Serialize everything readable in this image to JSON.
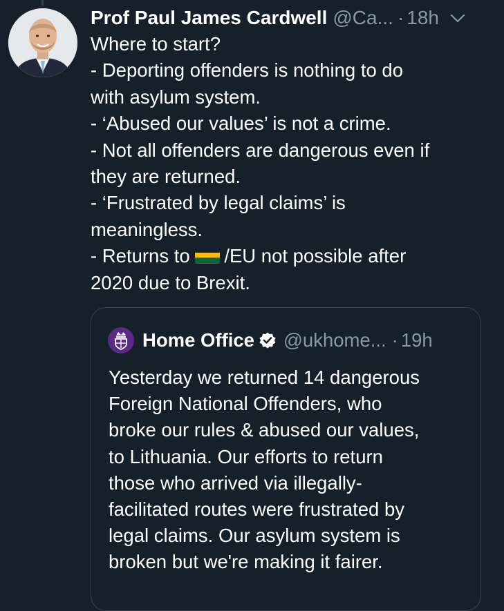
{
  "tweet": {
    "author_name": "Prof Paul James Cardwell",
    "author_handle": "@Ca...",
    "separator": "·",
    "time": "18h",
    "menu_icon": "chevron-down-icon",
    "avatar_icon": "profile-photo",
    "lines": [
      "Where to start?",
      "- Deporting offenders is nothing to do",
      "with asylum system.",
      "- ‘Abused our values’ is not a crime.",
      "- Not all offenders are dangerous even if",
      "they are returned.",
      "- ‘Frustrated by legal claims’ is",
      "meaningless."
    ],
    "returns_prefix": "- Returns to ",
    "flag_icon": "lithuania-flag-icon",
    "returns_suffix": "/EU not possible after",
    "last_line": "2020 due to Brexit."
  },
  "quote": {
    "author_name": "Home Office",
    "verified_icon": "verified-badge-icon",
    "author_handle": "@ukhome...",
    "separator": "·",
    "time": "19h",
    "lines": [
      "Yesterday we returned 14 dangerous",
      "Foreign National Offenders, who",
      "broke our rules & abused our values,",
      "to Lithuania. Our efforts to return",
      "those who arrived via illegally-",
      "facilitated routes were frustrated by",
      "legal claims. Our asylum system is",
      "broken but we're making it fairer."
    ]
  },
  "colors": {
    "background": "#15202b",
    "text_primary": "#ffffff",
    "text_secondary": "#8899a6",
    "border": "#38444d",
    "home_office_purple": "#5b2a86",
    "flag_yellow": "#fdb913",
    "flag_green": "#006a44",
    "flag_red": "#c1272d"
  }
}
